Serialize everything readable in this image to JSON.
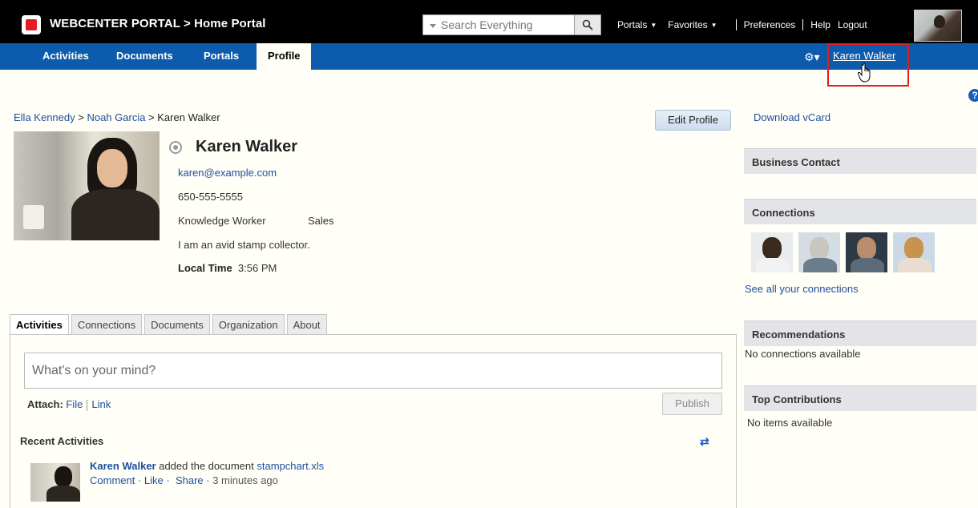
{
  "header": {
    "title": "WEBCENTER PORTAL > Home Portal",
    "search_placeholder": "Search Everything",
    "links": {
      "portals": "Portals",
      "favorites": "Favorites",
      "preferences": "Preferences",
      "help": "Help",
      "logout": "Logout"
    }
  },
  "nav": {
    "tabs": [
      "Activities",
      "Documents",
      "Portals",
      "Profile"
    ],
    "active_tab": "Profile",
    "user": "Karen Walker"
  },
  "breadcrumb": {
    "items": [
      "Ella Kennedy",
      "Noah Garcia"
    ],
    "sep": " > ",
    "current": "Karen Walker"
  },
  "profile": {
    "edit_label": "Edit Profile",
    "name": "Karen Walker",
    "email": "karen@example.com",
    "phone": "650-555-5555",
    "title": "Knowledge Worker",
    "department": "Sales",
    "bio": "I am an avid stamp collector.",
    "local_time_label": "Local Time",
    "local_time": "3:56 PM"
  },
  "tabs": [
    "Activities",
    "Connections",
    "Documents",
    "Organization",
    "About"
  ],
  "activity": {
    "status_placeholder": "What's on your mind?",
    "attach_label": "Attach:",
    "attach_file": "File",
    "attach_link": "Link",
    "publish_label": "Publish",
    "recent_title": "Recent Activities",
    "item": {
      "actor": "Karen Walker",
      "verb": " added the document ",
      "doc": "stampchart.xls",
      "comment": "Comment",
      "like": "Like",
      "share": "Share",
      "time": "3 minutes ago"
    }
  },
  "sidebar": {
    "vcard": "Download vCard",
    "business_contact": "Business Contact",
    "connections": "Connections",
    "see_all": "See all your connections",
    "recommendations": "Recommendations",
    "no_connections": "No connections available",
    "top_contributions": "Top Contributions",
    "no_items": "No items available"
  },
  "colors": {
    "top_bar": "#000000",
    "nav_bar": "#0d5bad",
    "link": "#1f4e9c",
    "highlight": "#e01e1e"
  }
}
